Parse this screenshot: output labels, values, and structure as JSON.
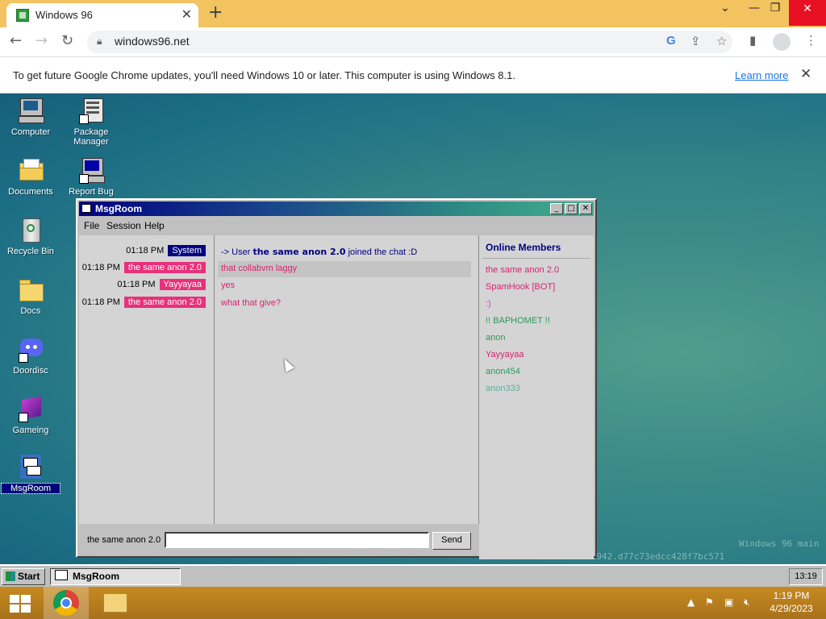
{
  "browser": {
    "tab_title": "Windows 96",
    "url": "windows96.net",
    "info_bar": {
      "message": "To get future Google Chrome updates, you'll need Windows 10 or later. This computer is using Windows 8.1.",
      "link": "Learn more"
    }
  },
  "desktop": {
    "icons": [
      {
        "label": "Computer"
      },
      {
        "label": "Package Manager"
      },
      {
        "label": "Documents"
      },
      {
        "label": "Report Bug"
      },
      {
        "label": "Recycle Bin"
      },
      {
        "label": "Docs"
      },
      {
        "label": "Doordisc"
      },
      {
        "label": "Gameing"
      },
      {
        "label": "MsgRoom"
      }
    ],
    "watermark_line1": "Windows 96 main",
    "watermark_line2": "efa922.230410-1942.d77c73edcc428f7bc571"
  },
  "msgroom": {
    "title": "MsgRoom",
    "menu": [
      "File",
      "Session",
      "Help"
    ],
    "log": [
      {
        "time": "01:18 PM",
        "nick": "System",
        "nick_color": "#000080"
      },
      {
        "time": "01:18 PM",
        "nick": "the same anon 2.0",
        "nick_color": "#e8317a"
      },
      {
        "time": "01:18 PM",
        "nick": "Yayyayaa",
        "nick_color": "#e8317a"
      },
      {
        "time": "01:18 PM",
        "nick": "the same anon 2.0",
        "nick_color": "#e8317a"
      }
    ],
    "messages": {
      "system_prefix": "-> User",
      "system_user": "the same anon 2.0",
      "system_suffix": "joined the chat :D",
      "lines": [
        "that collabvm laggy",
        "yes",
        "what that give?"
      ]
    },
    "online_title": "Online Members",
    "members": [
      {
        "name": "the same anon 2.0",
        "color": "#d6246e"
      },
      {
        "name": "SpamHook [BOT]",
        "color": "#d6246e"
      },
      {
        "name": ":)",
        "color": "#c04ac0"
      },
      {
        "name": "!! BAPHOMET !!",
        "color": "#2a9a5a"
      },
      {
        "name": "anon",
        "color": "#2a9a5a"
      },
      {
        "name": "Yayyayaa",
        "color": "#d6246e"
      },
      {
        "name": "anon454",
        "color": "#2a9a5a"
      },
      {
        "name": "anon333",
        "color": "#5ab39a"
      }
    ],
    "current_nick": "the same anon 2.0",
    "input_value": "",
    "send_label": "Send"
  },
  "w96_taskbar": {
    "start_label": "Start",
    "task_label": "MsgRoom",
    "clock": "13:19"
  },
  "host_taskbar": {
    "time": "1:19 PM",
    "date": "4/29/2023"
  },
  "colors": {
    "chrome_frame": "#f2c35f",
    "title_gradient_start": "#000080",
    "nick_system": "#000080",
    "nick_user": "#e8317a"
  }
}
